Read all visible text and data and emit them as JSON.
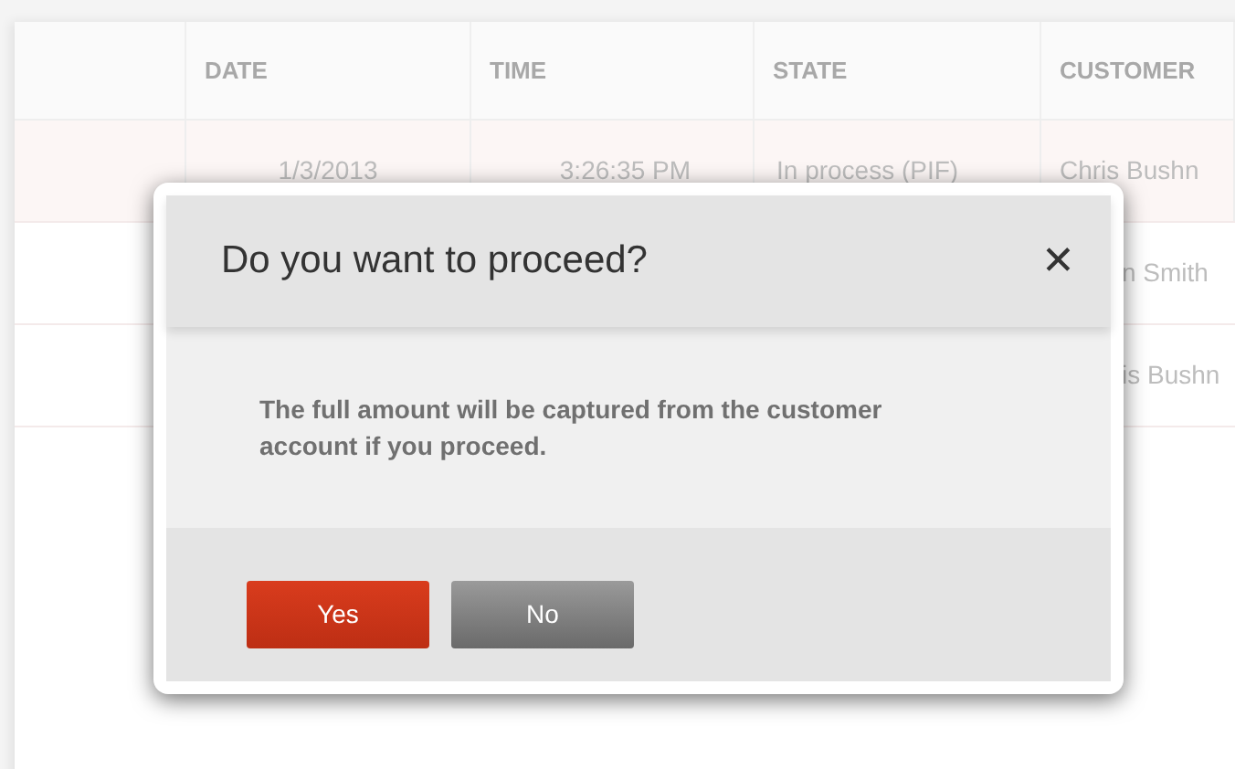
{
  "table": {
    "columns": [
      "",
      "DATE",
      "TIME",
      "STATE",
      "CUSTOMER"
    ],
    "rows": [
      {
        "selected": true,
        "cells": [
          "",
          "1/3/2013",
          "3:26:35 PM",
          "In process (PIF)",
          "Chris Bushn"
        ]
      },
      {
        "selected": false,
        "cells": [
          "",
          "",
          "",
          "",
          "n Smith"
        ]
      },
      {
        "selected": false,
        "cells": [
          "",
          "",
          "",
          "",
          "is Bushn"
        ]
      }
    ]
  },
  "dialog": {
    "title": "Do you want to proceed?",
    "close": "✕",
    "message": "The full amount will be captured from the customer account if you proceed.",
    "buttons": [
      {
        "label": "Yes",
        "kind": "primary"
      },
      {
        "label": "No",
        "kind": "secondary"
      }
    ]
  }
}
